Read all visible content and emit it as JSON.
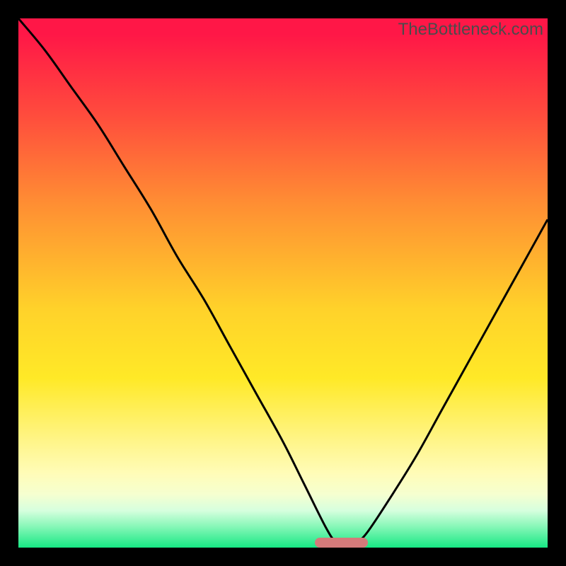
{
  "watermark": "TheBottleneck.com",
  "colors": {
    "frame": "#000000",
    "curve": "#000000",
    "marker": "#d47a7a"
  },
  "chart_data": {
    "type": "line",
    "title": "",
    "xlabel": "",
    "ylabel": "",
    "xlim": [
      0,
      100
    ],
    "ylim": [
      0,
      100
    ],
    "note": "Values are visually estimated from the curve against the plot area; higher y = higher bottleneck. Gradient background encodes severity (green=0, red=100).",
    "x": [
      0,
      5,
      10,
      15,
      20,
      25,
      30,
      35,
      40,
      45,
      50,
      54,
      58,
      60,
      62,
      64,
      66,
      70,
      75,
      80,
      85,
      90,
      95,
      100
    ],
    "values": [
      100,
      94,
      87,
      80,
      72,
      64,
      55,
      47,
      38,
      29,
      20,
      12,
      4,
      1,
      0,
      1,
      3,
      9,
      17,
      26,
      35,
      44,
      53,
      62
    ],
    "marker": {
      "x_start": 56,
      "x_end": 66,
      "y": 0
    }
  }
}
